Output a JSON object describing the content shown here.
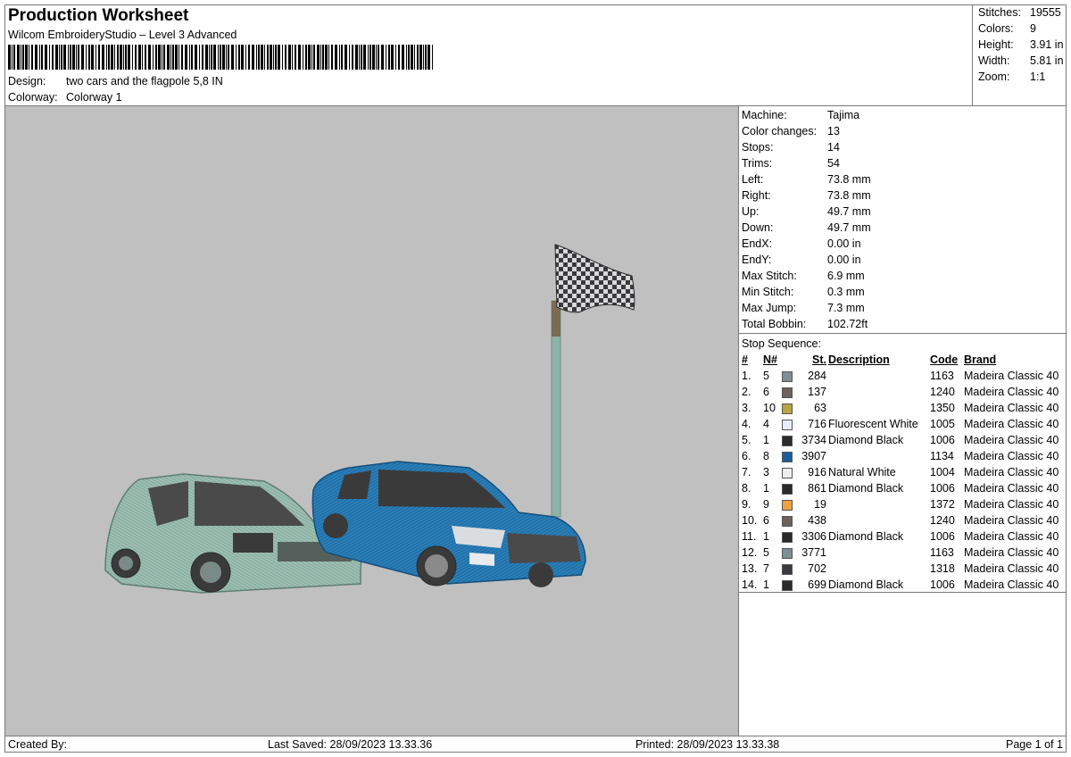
{
  "header": {
    "title": "Production Worksheet",
    "subtitle": "Wilcom EmbroideryStudio – Level 3 Advanced",
    "design_label": "Design:",
    "design_value": "two cars and the flagpole 5,8 IN",
    "colorway_label": "Colorway:",
    "colorway_value": "Colorway 1"
  },
  "summary": [
    {
      "label": "Stitches:",
      "value": "19555"
    },
    {
      "label": "Colors:",
      "value": "9"
    },
    {
      "label": "Height:",
      "value": "3.91 in"
    },
    {
      "label": "Width:",
      "value": "5.81 in"
    },
    {
      "label": "Zoom:",
      "value": "1:1"
    }
  ],
  "machine_info": [
    {
      "label": "Machine:",
      "value": "Tajima"
    },
    {
      "label": "Color changes:",
      "value": "13"
    },
    {
      "label": "Stops:",
      "value": "14"
    },
    {
      "label": "Trims:",
      "value": "54"
    },
    {
      "label": "Left:",
      "value": "73.8 mm"
    },
    {
      "label": "Right:",
      "value": "73.8 mm"
    },
    {
      "label": "Up:",
      "value": "49.7 mm"
    },
    {
      "label": "Down:",
      "value": "49.7 mm"
    },
    {
      "label": "EndX:",
      "value": "0.00 in"
    },
    {
      "label": "EndY:",
      "value": "0.00 in"
    },
    {
      "label": "Max Stitch:",
      "value": "6.9 mm"
    },
    {
      "label": "Min Stitch:",
      "value": "0.3 mm"
    },
    {
      "label": "Max Jump:",
      "value": "7.3 mm"
    },
    {
      "label": "Total Bobbin:",
      "value": "102.72ft"
    }
  ],
  "stop_sequence": {
    "title": "Stop Sequence:",
    "columns": {
      "num": "#",
      "needle": "N#",
      "stitches": "St.",
      "description": "Description",
      "code": "Code",
      "brand": "Brand"
    },
    "rows": [
      {
        "num": "1.",
        "needle": "5",
        "color": "#7f8e91",
        "stitches": "284",
        "description": "",
        "code": "1163",
        "brand": "Madeira Classic 40"
      },
      {
        "num": "2.",
        "needle": "6",
        "color": "#6b625e",
        "stitches": "137",
        "description": "",
        "code": "1240",
        "brand": "Madeira Classic 40"
      },
      {
        "num": "3.",
        "needle": "10",
        "color": "#b5a642",
        "stitches": "63",
        "description": "",
        "code": "1350",
        "brand": "Madeira Classic 40"
      },
      {
        "num": "4.",
        "needle": "4",
        "color": "#e8eaff",
        "stitches": "716",
        "description": "Fluorescent White",
        "code": "1005",
        "brand": "Madeira Classic 40"
      },
      {
        "num": "5.",
        "needle": "1",
        "color": "#2a2a2a",
        "stitches": "3734",
        "description": "Diamond Black",
        "code": "1006",
        "brand": "Madeira Classic 40"
      },
      {
        "num": "6.",
        "needle": "8",
        "color": "#1a5d9a",
        "stitches": "3907",
        "description": "",
        "code": "1134",
        "brand": "Madeira Classic 40"
      },
      {
        "num": "7.",
        "needle": "3",
        "color": "#eeeeee",
        "stitches": "916",
        "description": "Natural White",
        "code": "1004",
        "brand": "Madeira Classic 40"
      },
      {
        "num": "8.",
        "needle": "1",
        "color": "#2a2a2a",
        "stitches": "861",
        "description": "Diamond Black",
        "code": "1006",
        "brand": "Madeira Classic 40"
      },
      {
        "num": "9.",
        "needle": "9",
        "color": "#f0a040",
        "stitches": "19",
        "description": "",
        "code": "1372",
        "brand": "Madeira Classic 40"
      },
      {
        "num": "10.",
        "needle": "6",
        "color": "#6b625e",
        "stitches": "438",
        "description": "",
        "code": "1240",
        "brand": "Madeira Classic 40"
      },
      {
        "num": "11.",
        "needle": "1",
        "color": "#2a2a2a",
        "stitches": "3306",
        "description": "Diamond Black",
        "code": "1006",
        "brand": "Madeira Classic 40"
      },
      {
        "num": "12.",
        "needle": "5",
        "color": "#7f8e91",
        "stitches": "3771",
        "description": "",
        "code": "1163",
        "brand": "Madeira Classic 40"
      },
      {
        "num": "13.",
        "needle": "7",
        "color": "#3a3a3e",
        "stitches": "702",
        "description": "",
        "code": "1318",
        "brand": "Madeira Classic 40"
      },
      {
        "num": "14.",
        "needle": "1",
        "color": "#2a2a2a",
        "stitches": "699",
        "description": "Diamond Black",
        "code": "1006",
        "brand": "Madeira Classic 40"
      }
    ]
  },
  "footer": {
    "created_by": "Created By:",
    "last_saved": "Last Saved: 28/09/2023 13.33.36",
    "printed": "Printed: 28/09/2023 13.33.38",
    "page": "Page 1 of 1"
  },
  "colors": {
    "canvas_bg": "#c0c0c0",
    "car_left": "#9cbfb2",
    "car_right": "#2a7fb8",
    "pole": "#8fb2a8",
    "flag_dark": "#3a3a3e",
    "flag_light": "#d8d8d8"
  }
}
